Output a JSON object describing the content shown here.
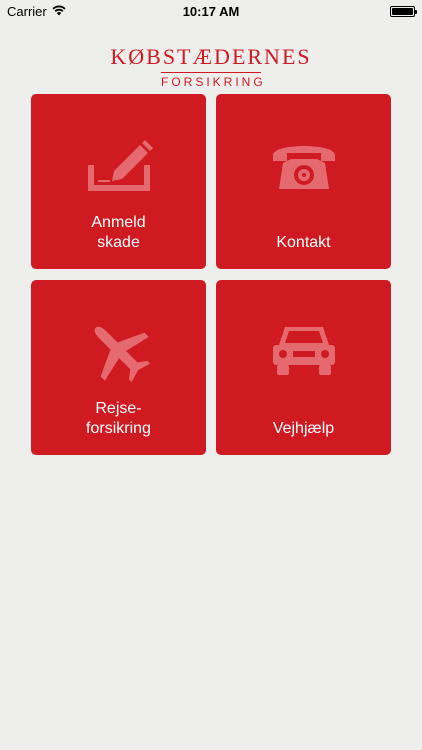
{
  "status": {
    "carrier": "Carrier",
    "time": "10:17 AM"
  },
  "logo": {
    "title": "KØBSTÆDERNES",
    "subtitle": "FORSIKRING"
  },
  "tiles": [
    {
      "label_line1": "Anmeld",
      "label_line2": "skade",
      "icon": "pencil-form-icon"
    },
    {
      "label_line1": "Kontakt",
      "label_line2": "",
      "icon": "telephone-icon"
    },
    {
      "label_line1": "Rejse-",
      "label_line2": "forsikring",
      "icon": "airplane-icon"
    },
    {
      "label_line1": "Vejhjælp",
      "label_line2": "",
      "icon": "car-icon"
    }
  ],
  "colors": {
    "brand": "#cf1a22",
    "background": "#eeeeec",
    "icon": "#e46a6f"
  }
}
